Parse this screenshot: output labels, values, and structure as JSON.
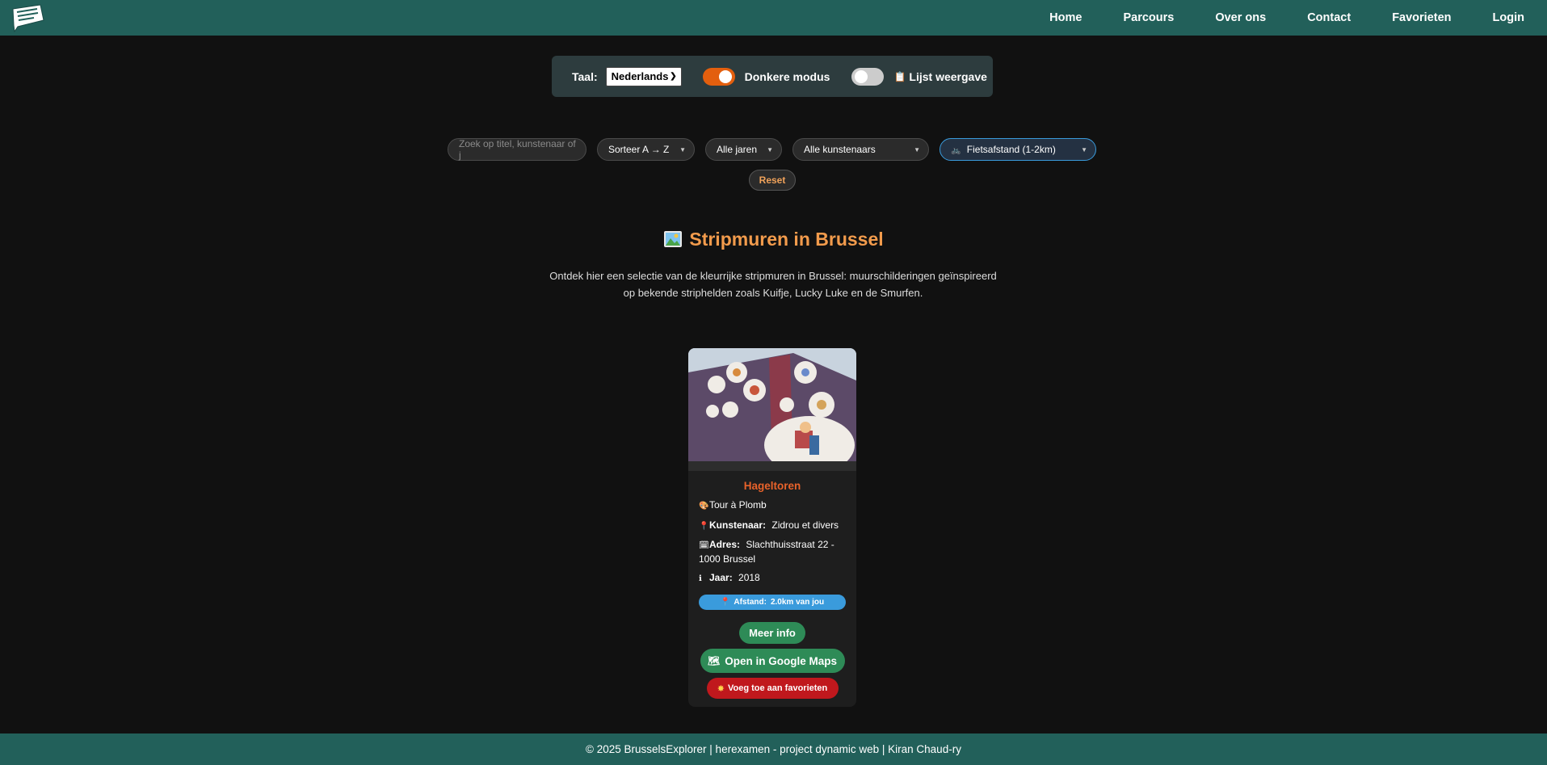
{
  "nav": {
    "links": [
      "Home",
      "Parcours",
      "Over ons",
      "Contact",
      "Favorieten",
      "Login"
    ]
  },
  "settings": {
    "language_label": "Taal:",
    "language_value": "Nederlands",
    "dark_mode_label": "Donkere modus",
    "dark_mode_on": true,
    "list_view_label": "Lijst weergave",
    "list_view_on": false
  },
  "filters": {
    "search_placeholder": "Zoek op titel, kunstenaar of j",
    "sort": "Sorteer A → Z",
    "years": "Alle jaren",
    "artists": "Alle kunstenaars",
    "distance": "Fietsafstand (1-2km)",
    "reset": "Reset"
  },
  "main": {
    "title": "Stripmuren in Brussel",
    "intro": "Ontdek hier een selectie van de kleurrijke stripmuren in Brussel: muurschilderingen geïnspireerd op bekende striphelden zoals Kuifje, Lucky Luke en de Smurfen."
  },
  "card": {
    "title": "Hageltoren",
    "subtitle": "Tour à Plomb",
    "artist_label": "Kunstenaar:",
    "artist_value": "Zidrou et divers",
    "address_label": "Adres:",
    "address_value": "Slachthuisstraat 22 - 1000 Brussel",
    "year_label": "Jaar:",
    "year_value": "2018",
    "distance_label": "Afstand:",
    "distance_value": "2.0km van jou",
    "more_info": "Meer info",
    "maps": "Open in Google Maps",
    "favorite": "Voeg toe aan favorieten"
  },
  "footer": {
    "text": "© 2025 BrusselsExplorer | herexamen - project dynamic web | Kiran Chaud-ry"
  },
  "colors": {
    "header": "#22605a",
    "accent": "#f29b4c",
    "card_title": "#e8622a",
    "green_button": "#2e8b57",
    "red_button": "#c0181d",
    "distance_badge": "#3a9bdc"
  }
}
